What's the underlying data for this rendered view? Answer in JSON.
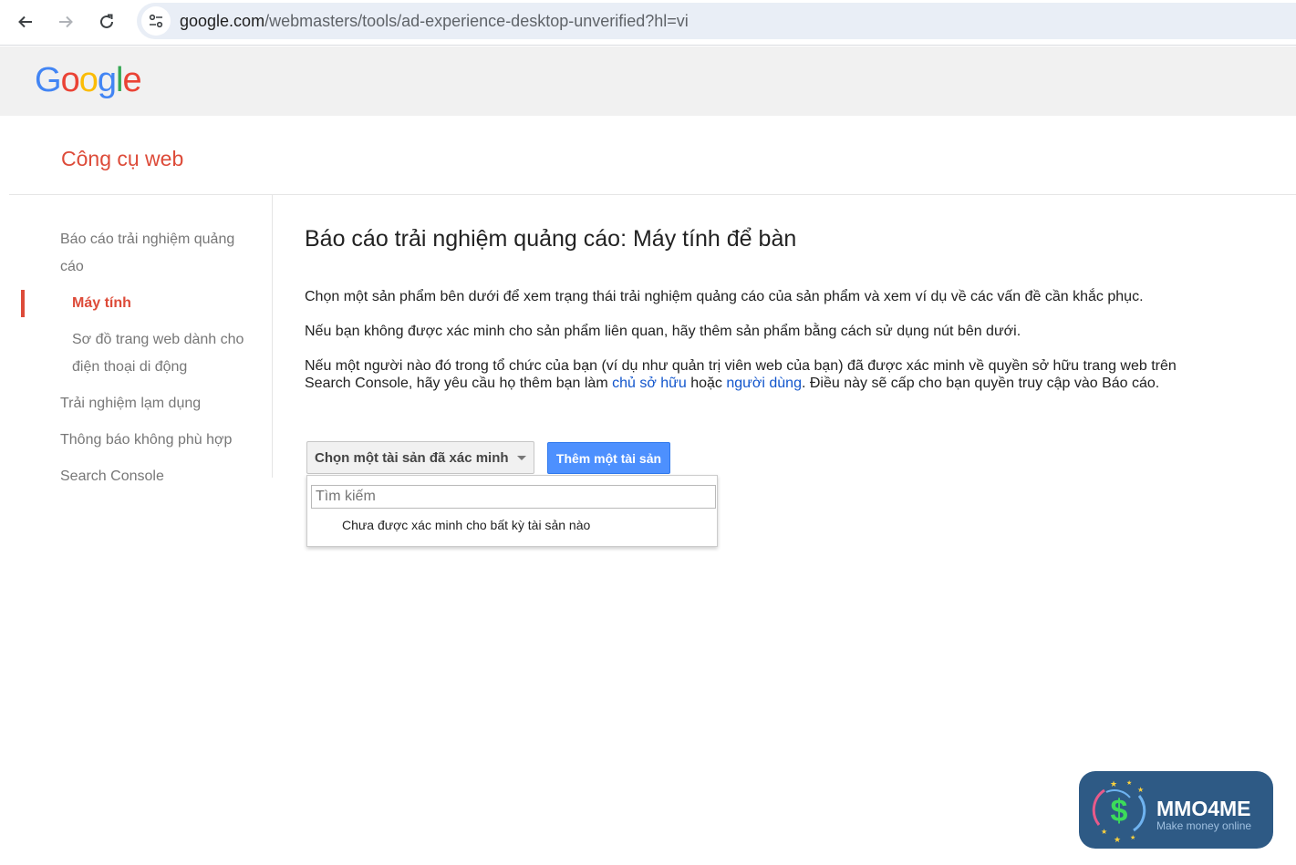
{
  "browser": {
    "url_host": "google.com",
    "url_path": "/webmasters/tools/ad-experience-desktop-unverified?hl=vi"
  },
  "header": {
    "logo_letters": [
      "G",
      "o",
      "o",
      "g",
      "l",
      "e"
    ],
    "logo_colors": [
      "#4285f4",
      "#ea4335",
      "#fbbc05",
      "#4285f4",
      "#34a853",
      "#ea4335"
    ]
  },
  "product": {
    "title": "Công cụ web"
  },
  "sidebar": {
    "items": [
      {
        "label_1": "Báo cáo trải nghiệm quảng",
        "label_2": "cáo"
      },
      {
        "label": "Máy tính"
      },
      {
        "label_1": "Sơ đồ trang web dành cho",
        "label_2": "điện thoại di động"
      },
      {
        "label": "Trải nghiệm lạm dụng"
      },
      {
        "label": "Thông báo không phù hợp"
      },
      {
        "label": "Search Console"
      }
    ]
  },
  "main": {
    "title": "Báo cáo trải nghiệm quảng cáo: Máy tính để bàn",
    "para1": "Chọn một sản phẩm bên dưới để xem trạng thái trải nghiệm quảng cáo của sản phẩm và xem ví dụ về các vấn đề cần khắc phục.",
    "para2": "Nếu bạn không được xác minh cho sản phẩm liên quan, hãy thêm sản phẩm bằng cách sử dụng nút bên dưới.",
    "para3_start": "Nếu một người nào đó trong tổ chức của bạn (ví dụ như quản trị viên web của bạn) đã được xác minh về quyền sở hữu trang web trên Search Console, hãy yêu cầu họ thêm bạn làm ",
    "para3_link1": "chủ sở hữu",
    "para3_mid": " hoặc ",
    "para3_link2": "người dùng",
    "para3_end": ". Điều này sẽ cấp cho bạn quyền truy cập vào Báo cáo."
  },
  "controls": {
    "select_label": "Chọn một tài sản đã xác minh",
    "add_button": "Thêm một tài sản",
    "search_placeholder": "Tìm kiếm",
    "empty_message": "Chưa được xác minh cho bất kỳ tài sản nào"
  },
  "badge": {
    "title": "MMO4ME",
    "subtitle": "Make money online"
  }
}
